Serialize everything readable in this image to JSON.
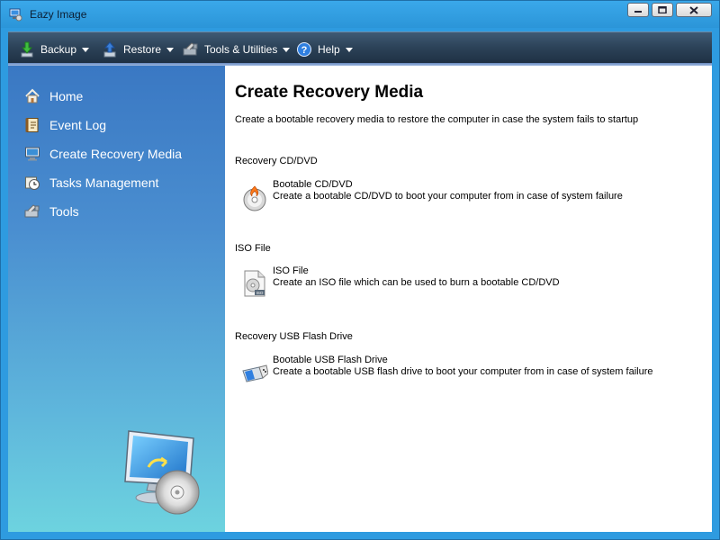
{
  "window": {
    "title": "Eazy Image",
    "icon": "app-icon"
  },
  "window_controls": [
    {
      "name": "minimize",
      "icon": "minimize-icon"
    },
    {
      "name": "maximize",
      "icon": "maximize-icon"
    },
    {
      "name": "close",
      "icon": "close-icon"
    }
  ],
  "menu": {
    "backup": {
      "label": "Backup",
      "icon": "backup-arrow-icon"
    },
    "restore": {
      "label": "Restore",
      "icon": "restore-icon"
    },
    "tools": {
      "label": "Tools & Utilities",
      "icon": "tools-icon"
    },
    "help": {
      "label": "Help",
      "icon": "help-icon"
    }
  },
  "sidebar": {
    "items": [
      {
        "label": "Home",
        "icon": "home-icon"
      },
      {
        "label": "Event Log",
        "icon": "event-log-icon"
      },
      {
        "label": "Create Recovery Media",
        "icon": "monitor-icon"
      },
      {
        "label": "Tasks Management",
        "icon": "clock-icon"
      },
      {
        "label": "Tools",
        "icon": "tools-icon"
      }
    ]
  },
  "main": {
    "title": "Create Recovery Media",
    "description": "Create a bootable recovery media to restore the computer in case the system fails to startup",
    "sections": [
      {
        "heading": "Recovery CD/DVD",
        "option_title": "Bootable CD/DVD",
        "option_desc": "Create a bootable CD/DVD to boot your computer from in case of system failure",
        "icon": "cd-burn-icon"
      },
      {
        "heading": "ISO File",
        "option_title": "ISO File",
        "option_desc": "Create an ISO file which can be used to burn a bootable CD/DVD",
        "icon": "iso-file-icon"
      },
      {
        "heading": "Recovery USB Flash Drive",
        "option_title": "Bootable USB Flash Drive",
        "option_desc": "Create a bootable USB flash drive to boot your computer from in case of system failure",
        "icon": "usb-drive-icon"
      }
    ]
  },
  "colors": {
    "titlebar": "#2e9be0",
    "menubar": "#2c4258",
    "sidebar_top": "#3a78c3",
    "sidebar_bottom": "#6dd3df"
  }
}
